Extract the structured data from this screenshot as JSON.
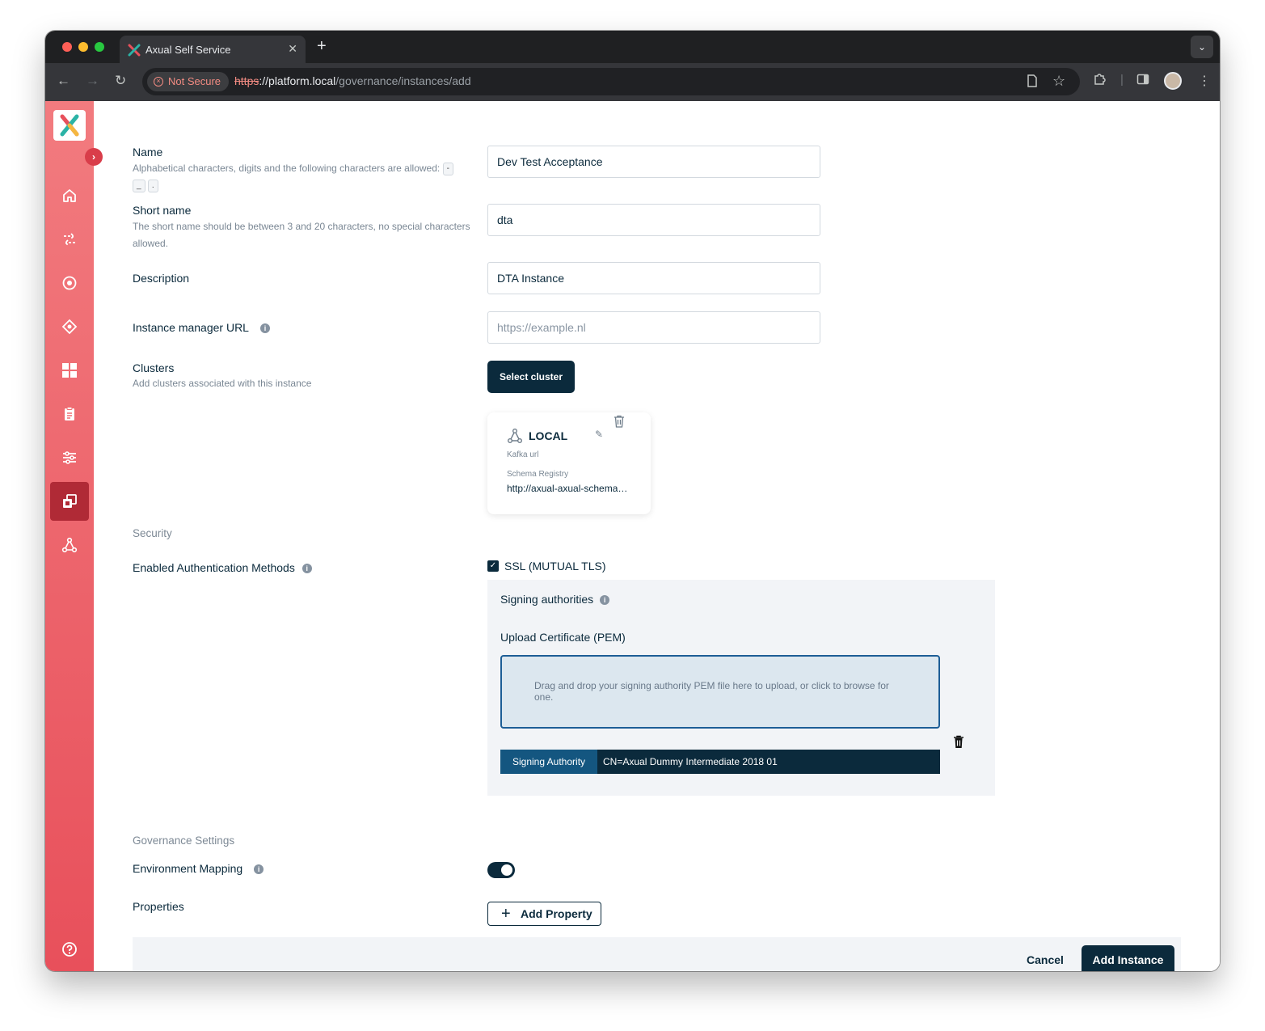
{
  "browser": {
    "tab_title": "Axual Self Service",
    "security_label": "Not Secure",
    "url_scheme": "https",
    "url_host": "://platform.local",
    "url_path": "/governance/instances/add"
  },
  "form": {
    "name": {
      "label": "Name",
      "hint": "Alphabetical characters, digits and the following characters are allowed:",
      "allowed_chars": [
        "-",
        "_",
        "."
      ],
      "value": "Dev Test Acceptance"
    },
    "short_name": {
      "label": "Short name",
      "hint": "The short name should be between 3 and 20 characters, no special characters allowed.",
      "value": "dta"
    },
    "description": {
      "label": "Description",
      "value": "DTA Instance"
    },
    "instance_manager_url": {
      "label": "Instance manager URL",
      "placeholder": "https://example.nl"
    },
    "clusters": {
      "label": "Clusters",
      "hint": "Add clusters associated with this instance",
      "select_button": "Select cluster",
      "cards": [
        {
          "name": "LOCAL",
          "kafka_url_label": "Kafka url",
          "schema_registry_label": "Schema Registry",
          "schema_registry_value": "http://axual-axual-schema…"
        }
      ]
    },
    "security": {
      "section_title": "Security",
      "auth_methods_label": "Enabled Authentication Methods",
      "ssl_label": "SSL (MUTUAL TLS)",
      "ssl_checked": true,
      "signing_authorities_label": "Signing authorities",
      "upload_label": "Upload Certificate (PEM)",
      "dropzone_text": "Drag and drop your signing authority PEM file here to upload, or click to browse for one.",
      "signing_authority_tag": "Signing Authority",
      "signing_authority_value": "CN=Axual Dummy Intermediate 2018 01"
    },
    "governance": {
      "section_title": "Governance Settings",
      "environment_mapping_label": "Environment Mapping",
      "environment_mapping_enabled": true,
      "properties_label": "Properties",
      "add_property_button": "Add Property"
    }
  },
  "footer": {
    "cancel_label": "Cancel",
    "submit_label": "Add Instance"
  },
  "colors": {
    "brand_dark": "#0b2a3c",
    "sidebar_top": "#f27b7f",
    "sidebar_bottom": "#e8505b",
    "sidebar_active": "#b02a36"
  }
}
